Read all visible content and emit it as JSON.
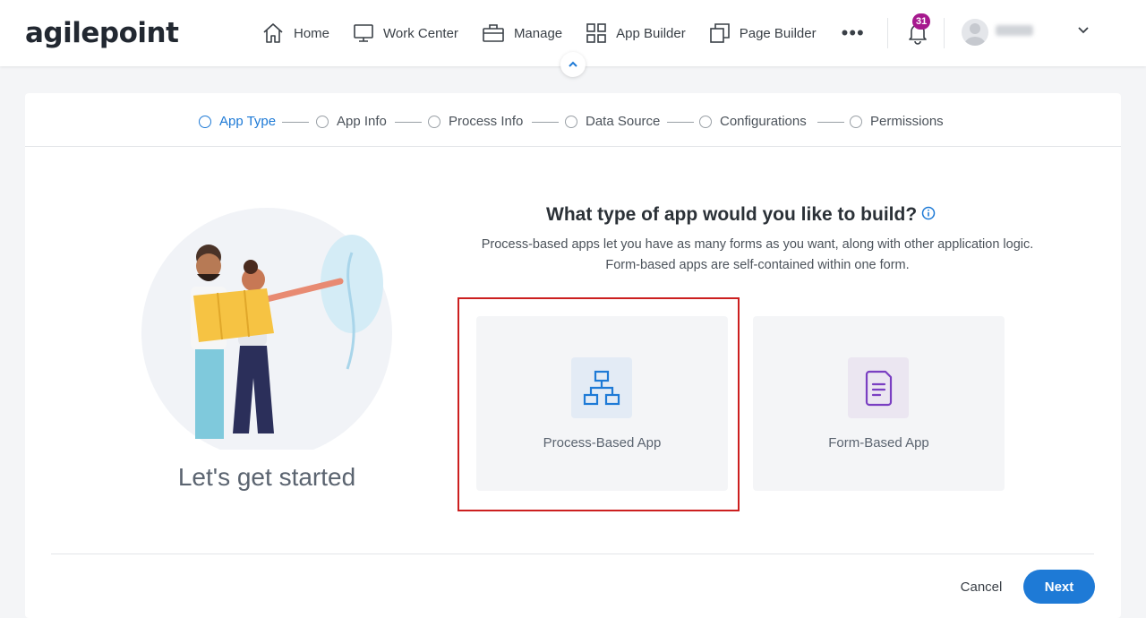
{
  "header": {
    "logo_text": "agilepoint",
    "nav": [
      {
        "label": "Home",
        "icon": "home-icon"
      },
      {
        "label": "Work Center",
        "icon": "monitor-icon"
      },
      {
        "label": "Manage",
        "icon": "briefcase-icon"
      },
      {
        "label": "App Builder",
        "icon": "grid-icon"
      },
      {
        "label": "Page Builder",
        "icon": "copy-icon"
      }
    ],
    "more": "•••",
    "notifications_count": "31"
  },
  "stepper": {
    "steps": [
      {
        "label": "App Type",
        "active": true
      },
      {
        "label": "App Info",
        "active": false
      },
      {
        "label": "Process Info",
        "active": false
      },
      {
        "label": "Data Source",
        "active": false
      },
      {
        "label": "Configurations",
        "active": false
      },
      {
        "label": "Permissions",
        "active": false
      }
    ]
  },
  "main": {
    "heading": "What type of app would you like to build?",
    "description": "Process-based apps let you have as many forms as you want, along with other application logic. Form-based apps are self-contained within one form.",
    "get_started": "Let's get started",
    "cards": [
      {
        "label": "Process-Based App",
        "icon": "process-hierarchy-icon",
        "icon_color": "#1e7ad6",
        "bg": "#e3ebf5"
      },
      {
        "label": "Form-Based App",
        "icon": "form-document-icon",
        "icon_color": "#7a3fc2",
        "bg": "#ebe6f1"
      }
    ]
  },
  "footer": {
    "cancel_label": "Cancel",
    "next_label": "Next"
  },
  "colors": {
    "accent": "#1e7ad6",
    "highlight_border": "#cc1f1f",
    "badge": "#a6198e"
  }
}
